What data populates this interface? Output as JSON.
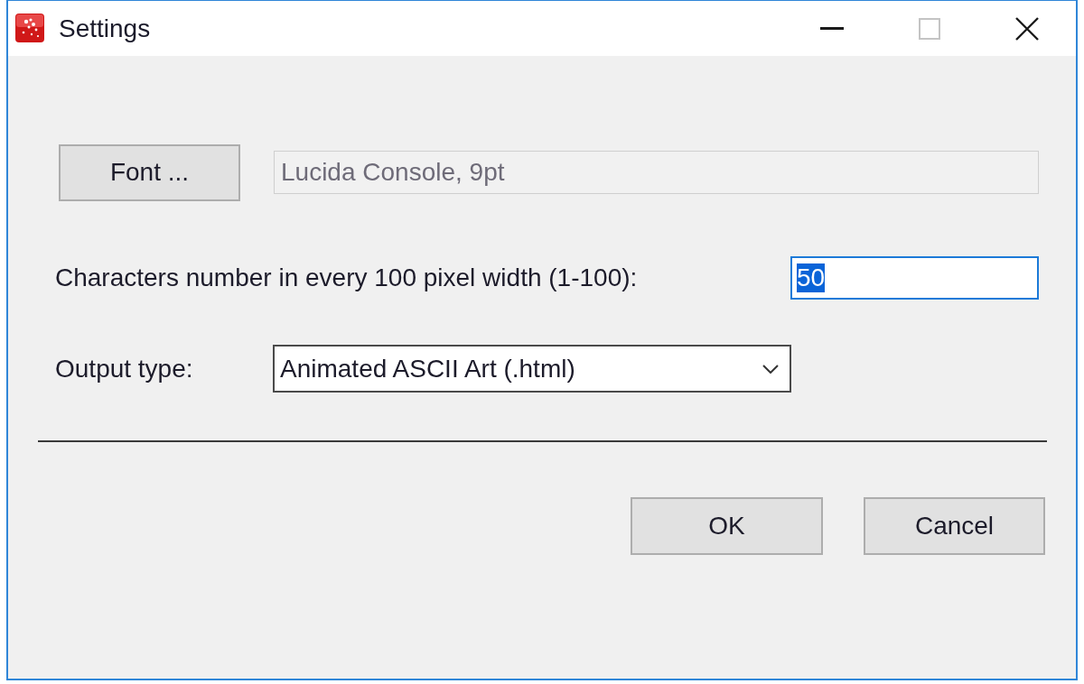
{
  "window": {
    "title": "Settings",
    "maximize_disabled": true
  },
  "font": {
    "button": "Font ...",
    "value": "Lucida Console, 9pt",
    "disabled": true
  },
  "characters": {
    "label": "Characters number in every 100 pixel width (1-100):",
    "value": "50",
    "focused": true,
    "text_selected": true
  },
  "output_type": {
    "label": "Output type:",
    "value": "Animated ASCII Art (.html)"
  },
  "buttons": [
    "OK",
    "Cancel"
  ]
}
